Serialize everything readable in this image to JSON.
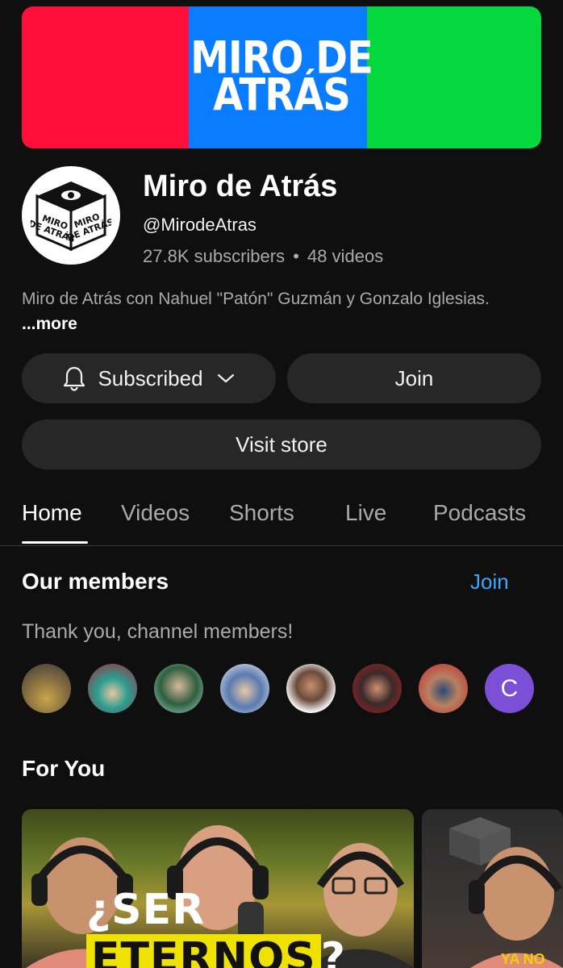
{
  "banner": {
    "title_line1": "MIRO DE",
    "title_line2": "ATRÁS",
    "colors": [
      "#ff0f3a",
      "#0a7cff",
      "#05d83e"
    ]
  },
  "channel": {
    "name": "Miro de Atrás",
    "handle": "@MirodeAtras",
    "subscribers": "27.8K subscribers",
    "separator": "•",
    "videos": "48 videos",
    "avatar_text_left": "MIRO DE ATRÁS",
    "avatar_text_right": "MIRO DE ATRÁS",
    "description": "Miro de Atrás con Nahuel \"Patón\" Guzmán y Gonzalo Iglesias.",
    "more_label": "...more"
  },
  "actions": {
    "subscribed_label": "Subscribed",
    "join_label": "Join",
    "store_label": "Visit store"
  },
  "tabs": [
    {
      "label": "Home",
      "active": true
    },
    {
      "label": "Videos",
      "active": false
    },
    {
      "label": "Shorts",
      "active": false
    },
    {
      "label": "Live",
      "active": false
    },
    {
      "label": "Podcasts",
      "active": false
    }
  ],
  "members": {
    "title": "Our members",
    "join_label": "Join",
    "thanks": "Thank you, channel members!",
    "last_initial": "C"
  },
  "for_you": {
    "title": "For You",
    "video1_caption_start": "¿SER",
    "video1_caption_highlight": "ETERNOS",
    "video1_caption_end": "?",
    "video2_caption": "YA NO"
  },
  "colors": {
    "background": "#0f0f0f",
    "button_bg": "#272727",
    "link_blue": "#3ea6ff",
    "member_avatar": "#7b4fd6"
  }
}
